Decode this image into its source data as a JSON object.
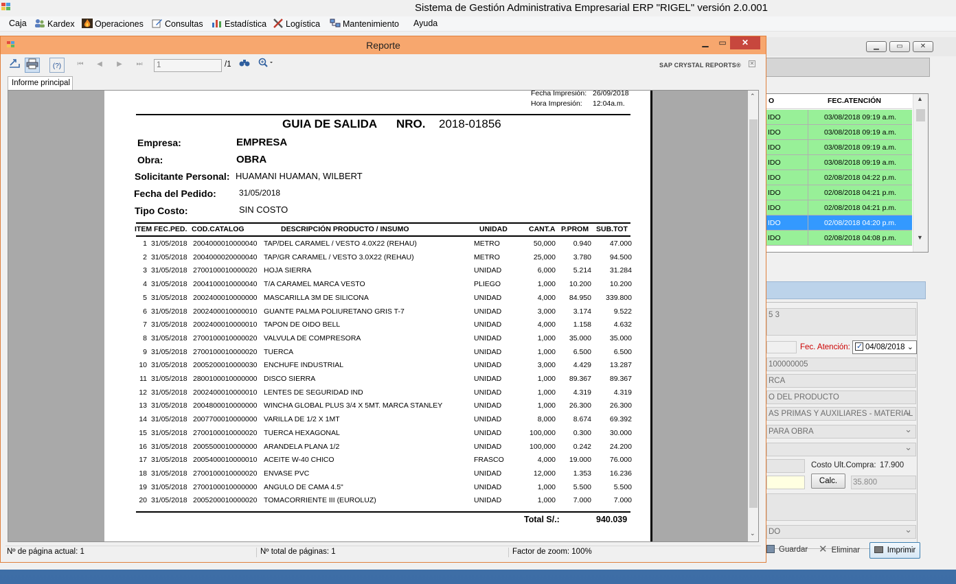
{
  "main_window": {
    "title": "Sistema de Gestión Administrativa Empresarial ERP  \"RIGEL\" versión 2.0.001"
  },
  "menu": [
    {
      "label": "Caja",
      "icon": ""
    },
    {
      "label": "Kardex",
      "icon": "people-icon"
    },
    {
      "label": "Operaciones",
      "icon": "fire-icon"
    },
    {
      "label": "Consultas",
      "icon": "edit-icon"
    },
    {
      "label": "Estadística",
      "icon": "bar-chart-icon"
    },
    {
      "label": "Logística",
      "icon": "tools-icon"
    },
    {
      "label": "Mantenimiento",
      "icon": "network-icon"
    },
    {
      "label": "Ayuda",
      "icon": ""
    }
  ],
  "report_window": {
    "title": "Reporte",
    "page_input": "1",
    "page_total": "/1",
    "brand": "SAP CRYSTAL REPORTS®",
    "tab": "Informe principal",
    "status": {
      "current_page": "Nº de página actual: 1",
      "total_pages": "Nº total de páginas: 1",
      "zoom": "Factor de zoom: 100%"
    }
  },
  "report": {
    "print_date_label": "Fecha Impresión:",
    "print_date": "26/09/2018",
    "print_time_label": "Hora Impresión:",
    "print_time": "12:04a.m.",
    "title": "GUIA DE SALIDA",
    "nro_label": "NRO.",
    "nro": "2018-01856",
    "empresa_label": "Empresa:",
    "empresa": "EMPRESA",
    "obra_label": "Obra:",
    "obra": "OBRA",
    "solicitante_label": "Solicitante Personal:",
    "solicitante": "HUAMANI HUAMAN, WILBERT",
    "fecha_pedido_label": "Fecha del Pedido:",
    "fecha_pedido": "31/05/2018",
    "tipo_costo_label": "Tipo Costo:",
    "tipo_costo": "SIN COSTO",
    "columns": [
      "ITEM",
      "FEC.PED.",
      "COD.CATALOG",
      "DESCRIPCIÓN PRODUCTO / INSUMO",
      "UNIDAD",
      "CANT.A",
      "P.PROM",
      "SUB.TOT"
    ],
    "rows": [
      [
        "1",
        "31/05/2018",
        "2004000010000040",
        "TAP/DEL CARAMEL / VESTO 4.0X22 (REHAU)",
        "METRO",
        "50,000",
        "0.940",
        "47.000"
      ],
      [
        "2",
        "31/05/2018",
        "2004000020000040",
        "TAP/GR CARAMEL / VESTO 3.0X22 (REHAU)",
        "METRO",
        "25,000",
        "3.780",
        "94.500"
      ],
      [
        "3",
        "31/05/2018",
        "2700100010000020",
        "HOJA SIERRA",
        "UNIDAD",
        "6,000",
        "5.214",
        "31.284"
      ],
      [
        "4",
        "31/05/2018",
        "2004100010000040",
        "T/A CARAMEL MARCA VESTO",
        "PLIEGO",
        "1,000",
        "10.200",
        "10.200"
      ],
      [
        "5",
        "31/05/2018",
        "2002400010000000",
        "MASCARILLA 3M DE SILICONA",
        "UNIDAD",
        "4,000",
        "84.950",
        "339.800"
      ],
      [
        "6",
        "31/05/2018",
        "2002400010000010",
        "GUANTE PALMA POLIURETANO GRIS T-7",
        "UNIDAD",
        "3,000",
        "3.174",
        "9.522"
      ],
      [
        "7",
        "31/05/2018",
        "2002400010000010",
        "TAPON DE OIDO BELL",
        "UNIDAD",
        "4,000",
        "1.158",
        "4.632"
      ],
      [
        "8",
        "31/05/2018",
        "2700100010000020",
        "VALVULA DE COMPRESORA",
        "UNIDAD",
        "1,000",
        "35.000",
        "35.000"
      ],
      [
        "9",
        "31/05/2018",
        "2700100010000020",
        "TUERCA",
        "UNIDAD",
        "1,000",
        "6.500",
        "6.500"
      ],
      [
        "10",
        "31/05/2018",
        "2005200010000030",
        "ENCHUFE INDUSTRIAL",
        "UNIDAD",
        "3,000",
        "4.429",
        "13.287"
      ],
      [
        "11",
        "31/05/2018",
        "2800100010000000",
        "DISCO SIERRA",
        "UNIDAD",
        "1,000",
        "89.367",
        "89.367"
      ],
      [
        "12",
        "31/05/2018",
        "2002400010000010",
        "LENTES DE SEGURIDAD IND",
        "UNIDAD",
        "1,000",
        "4.319",
        "4.319"
      ],
      [
        "13",
        "31/05/2018",
        "2004800010000000",
        "WINCHA GLOBAL PLUS 3/4 X 5MT. MARCA STANLEY",
        "UNIDAD",
        "1,000",
        "26.300",
        "26.300"
      ],
      [
        "14",
        "31/05/2018",
        "2007700010000000",
        "VARILLA DE 1/2 X 1MT",
        "UNIDAD",
        "8,000",
        "8.674",
        "69.392"
      ],
      [
        "15",
        "31/05/2018",
        "2700100010000020",
        "TUERCA HEXAGONAL",
        "UNIDAD",
        "100,000",
        "0.300",
        "30.000"
      ],
      [
        "16",
        "31/05/2018",
        "2005500010000000",
        "ARANDELA PLANA 1/2",
        "UNIDAD",
        "100,000",
        "0.242",
        "24.200"
      ],
      [
        "17",
        "31/05/2018",
        "2005400010000010",
        "ACEITE W-40 CHICO",
        "FRASCO",
        "4,000",
        "19.000",
        "76.000"
      ],
      [
        "18",
        "31/05/2018",
        "2700100010000020",
        "ENVASE PVC",
        "UNIDAD",
        "12,000",
        "1.353",
        "16.236"
      ],
      [
        "19",
        "31/05/2018",
        "2700100010000000",
        "ANGULO DE CAMA 4.5\"",
        "UNIDAD",
        "1,000",
        "5.500",
        "5.500"
      ],
      [
        "20",
        "31/05/2018",
        "2005200010000020",
        "TOMACORRIENTE III (EUROLUZ)",
        "UNIDAD",
        "1,000",
        "7.000",
        "7.000"
      ]
    ],
    "total_label": "Total  S/.:",
    "total": "940.039"
  },
  "background_form": {
    "grid_headers": [
      "O",
      "FEC.ATENCIÓN"
    ],
    "grid_rows": [
      {
        "estado": "IDO",
        "fecha": "03/08/2018 09:19 a.m.",
        "selected": false
      },
      {
        "estado": "IDO",
        "fecha": "03/08/2018 09:19 a.m.",
        "selected": false
      },
      {
        "estado": "IDO",
        "fecha": "03/08/2018 09:19 a.m.",
        "selected": false
      },
      {
        "estado": "IDO",
        "fecha": "03/08/2018 09:19 a.m.",
        "selected": false
      },
      {
        "estado": "IDO",
        "fecha": "02/08/2018 04:22 p.m.",
        "selected": false
      },
      {
        "estado": "IDO",
        "fecha": "02/08/2018 04:21 p.m.",
        "selected": false
      },
      {
        "estado": "IDO",
        "fecha": "02/08/2018 04:21 p.m.",
        "selected": false
      },
      {
        "estado": "IDO",
        "fecha": "02/08/2018 04:20 p.m.",
        "selected": true
      },
      {
        "estado": "IDO",
        "fecha": "02/08/2018 04:08 p.m.",
        "selected": false
      }
    ],
    "row_color": "#98f098",
    "selected_color": "#3399ff",
    "field_code": "5 3",
    "fec_atencion_label": "Fec. Atención:",
    "fec_atencion": "04/08/2018",
    "field_catalog": "100000005",
    "field_marca": "RCA",
    "field_producto": "O DEL PRODUCTO",
    "field_tipo": "AS PRIMAS Y AUXILIARES - MATERIAL",
    "field_destino": "PARA OBRA",
    "costo_label": "Costo Ult.Compra:",
    "costo": "17.900",
    "calc_button": "Calc.",
    "calc_value": "35.800",
    "field_estado": "DO",
    "guardar": "Guardar",
    "eliminar": "Eliminar",
    "imprimir": "Imprimir"
  }
}
